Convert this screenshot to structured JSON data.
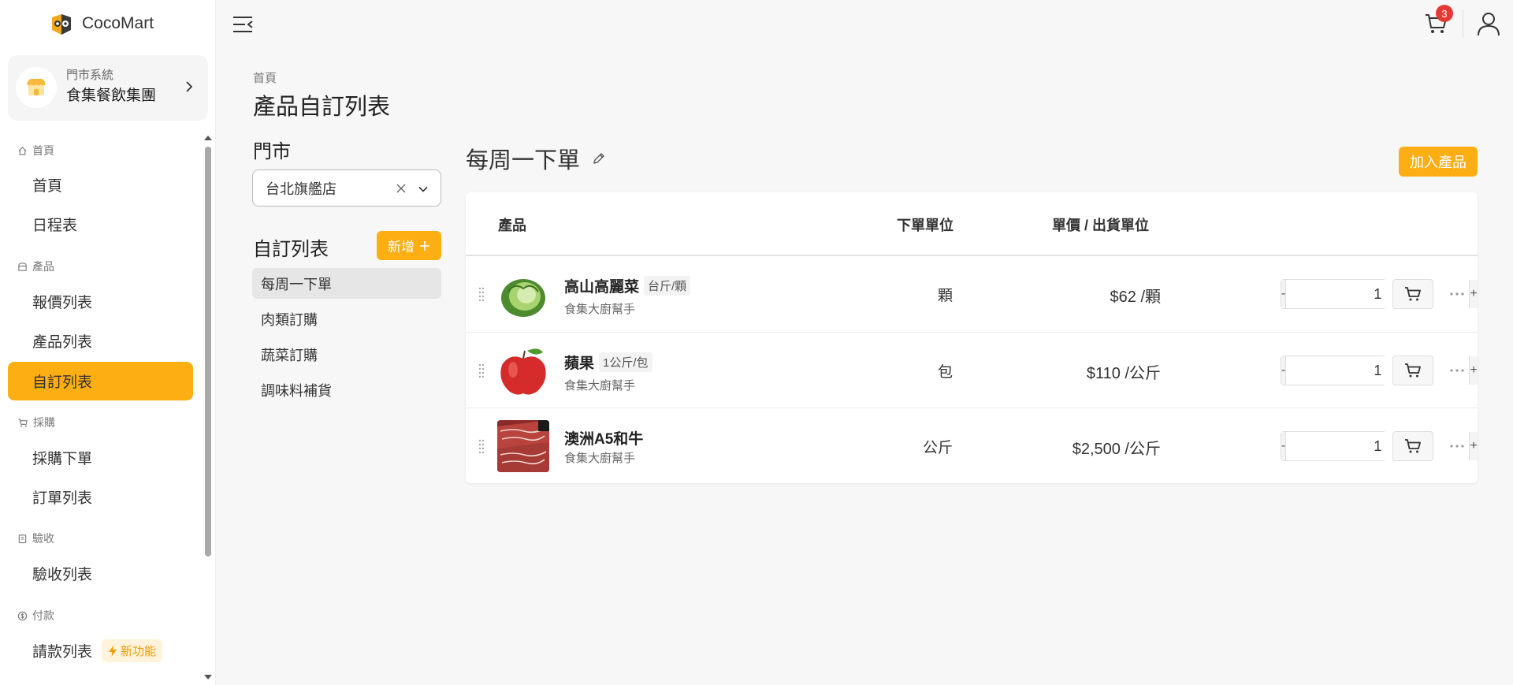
{
  "app": {
    "name": "CocoMart"
  },
  "store_card": {
    "subtitle": "門市系統",
    "name": "食集餐飲集團"
  },
  "nav": {
    "sections": [
      {
        "label": "首頁",
        "icon": "home-icon"
      },
      {
        "label": "產品",
        "icon": "box-icon"
      },
      {
        "label": "採購",
        "icon": "cart-icon"
      },
      {
        "label": "驗收",
        "icon": "clipboard-icon"
      },
      {
        "label": "付款",
        "icon": "dollar-icon"
      }
    ],
    "items": [
      {
        "label": "首頁"
      },
      {
        "label": "日程表"
      },
      {
        "label": "報價列表"
      },
      {
        "label": "產品列表"
      },
      {
        "label": "自訂列表"
      },
      {
        "label": "採購下單"
      },
      {
        "label": "訂單列表"
      },
      {
        "label": "驗收列表"
      },
      {
        "label": "請款列表",
        "badge": "新功能"
      }
    ],
    "active": "自訂列表"
  },
  "topbar": {
    "cart_count": "3"
  },
  "page": {
    "breadcrumb": "首頁",
    "title": "產品自訂列表"
  },
  "left_panel": {
    "store_label": "門市",
    "store_value": "台北旗艦店",
    "list_label": "自訂列表",
    "add_label": "新增",
    "lists": [
      "每周一下單",
      "肉類訂購",
      "蔬菜訂購",
      "調味料補貨"
    ]
  },
  "main": {
    "list_title": "每周一下單",
    "add_product_label": "加入產品",
    "columns": {
      "product": "產品",
      "unit": "下單單位",
      "price": "單價 / 出貨單位"
    },
    "rows": [
      {
        "name": "高山高麗菜",
        "spec": "台斤/顆",
        "supplier": "食集大廚幫手",
        "unit": "顆",
        "price": "$62 /顆",
        "qty": "1"
      },
      {
        "name": "蘋果",
        "spec": "1公斤/包",
        "supplier": "食集大廚幫手",
        "unit": "包",
        "price": "$110 /公斤",
        "qty": "1"
      },
      {
        "name": "澳洲A5和牛",
        "spec": "",
        "supplier": "食集大廚幫手",
        "unit": "公斤",
        "price": "$2,500 /公斤",
        "qty": "1"
      }
    ],
    "stepper": {
      "minus": "-",
      "plus": "+"
    }
  },
  "colors": {
    "accent": "#fdae13",
    "badge_red": "#e53935",
    "new_badge_bg": "#fff3dc",
    "new_badge_text": "#f39b00"
  }
}
